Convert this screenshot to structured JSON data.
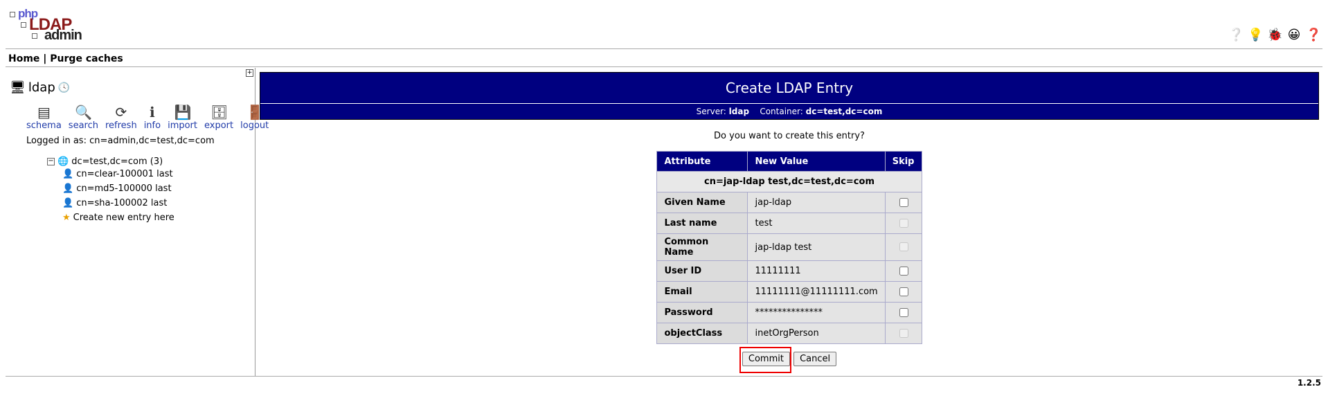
{
  "logo": {
    "php": "php",
    "ldap": "LDAP",
    "admin": "admin"
  },
  "menu": {
    "home": "Home",
    "sep": "|",
    "purge": "Purge caches"
  },
  "sidebar": {
    "server_name": "ldap",
    "actions": [
      {
        "label": "schema",
        "icon": "schema-icon"
      },
      {
        "label": "search",
        "icon": "search-icon"
      },
      {
        "label": "refresh",
        "icon": "refresh-icon"
      },
      {
        "label": "info",
        "icon": "info-icon"
      },
      {
        "label": "import",
        "icon": "import-icon"
      },
      {
        "label": "export",
        "icon": "export-icon"
      },
      {
        "label": "logout",
        "icon": "logout-icon"
      }
    ],
    "logged_in": "Logged in as: cn=admin,dc=test,dc=com",
    "tree": {
      "root": "dc=test,dc=com (3)",
      "items": [
        "cn=clear-100001 last",
        "cn=md5-100000 last",
        "cn=sha-100002 last",
        "Create new entry here"
      ]
    }
  },
  "main": {
    "title": "Create LDAP Entry",
    "server_label": "Server:",
    "server_value": "ldap",
    "container_label": "Container:",
    "container_value": "dc=test,dc=com",
    "prompt": "Do you want to create this entry?",
    "table": {
      "headers": [
        "Attribute",
        "New Value",
        "Skip"
      ],
      "dn": "cn=jap-ldap test,dc=test,dc=com",
      "rows": [
        {
          "attr": "Given Name",
          "value": "jap-ldap"
        },
        {
          "attr": "Last name",
          "value": "test"
        },
        {
          "attr": "Common Name",
          "value": "jap-ldap test"
        },
        {
          "attr": "User ID",
          "value": "11111111"
        },
        {
          "attr": "Email",
          "value": "11111111@11111111.com"
        },
        {
          "attr": "Password",
          "value": "***************"
        },
        {
          "attr": "objectClass",
          "value": "inetOrgPerson"
        }
      ]
    },
    "commit_label": "Commit",
    "cancel_label": "Cancel"
  },
  "version": "1.2.5",
  "colors": {
    "header_bg": "#000080",
    "highlight": "#ee0000",
    "link": "#1f3aa8"
  }
}
